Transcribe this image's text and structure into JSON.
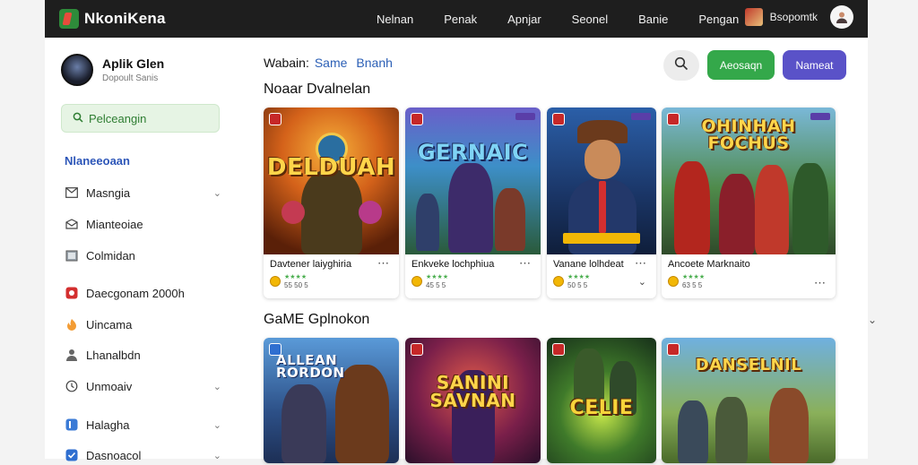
{
  "app": {
    "title": "NkoniKena",
    "brand_color": "#2e8b3a"
  },
  "nav": {
    "items": [
      "Nelnan",
      "Penak",
      "Apnjar",
      "Seonel",
      "Banie",
      "Pengan"
    ]
  },
  "profile": {
    "name": "Bsopomtk",
    "avatar_icon": "user-icon"
  },
  "sidebar": {
    "user_name": "Aplik Glen",
    "user_subtitle": "Dopoult Sanis",
    "promo_label": "Pelceangin",
    "section_label": "Nlaneeoaan",
    "items": [
      {
        "label": "Masngia",
        "icon": "mail-icon",
        "chevron": true
      },
      {
        "label": "Mianteoiae",
        "icon": "envelope-icon",
        "chevron": false
      },
      {
        "label": "Colmidan",
        "icon": "clipboard-icon",
        "chevron": false
      },
      {
        "label": "Daecgonam 2000h",
        "icon": "red-app-icon",
        "chevron": false
      },
      {
        "label": "Uincama",
        "icon": "flame-icon",
        "chevron": false
      },
      {
        "label": "Lhanalbdn",
        "icon": "person-icon",
        "chevron": false
      },
      {
        "label": "Unmoaiv",
        "icon": "clock-icon",
        "chevron": true
      },
      {
        "label": "Halagha",
        "icon": "blue-app-icon",
        "chevron": true
      },
      {
        "label": "Dasnoacol",
        "icon": "check-icon",
        "chevron": true
      }
    ]
  },
  "search": {
    "prefix": "Wabain:",
    "keyword1": "Same",
    "keyword2": "Bnanh"
  },
  "actions": {
    "green_label": "Aeosaqn",
    "blue_label": "Nameat",
    "search_icon": "search-icon"
  },
  "section1": {
    "title": "Noaar Dvalnelan",
    "cards": [
      {
        "art_title": "DELDUAH",
        "title": "Davtener laiyghiria",
        "rating": "55 50 5"
      },
      {
        "art_title": "GERNAIC",
        "title": "Enkveke lochphiua",
        "rating": "45 5 5"
      },
      {
        "art_title": "",
        "title": "Vanane lolhdeat",
        "rating": "50 5 5"
      },
      {
        "art_title": "OHINHAH FOCHUS",
        "title": "Ancoete Marknaito",
        "rating": "63 5 5"
      }
    ]
  },
  "section2": {
    "title": "GaME Gplnokon",
    "cards": [
      {
        "art_title": "ALLEAN RORDON"
      },
      {
        "art_title": "SANINI SAVNAN"
      },
      {
        "art_title": "CELIE"
      },
      {
        "art_title": "DANSELNIL"
      }
    ]
  }
}
